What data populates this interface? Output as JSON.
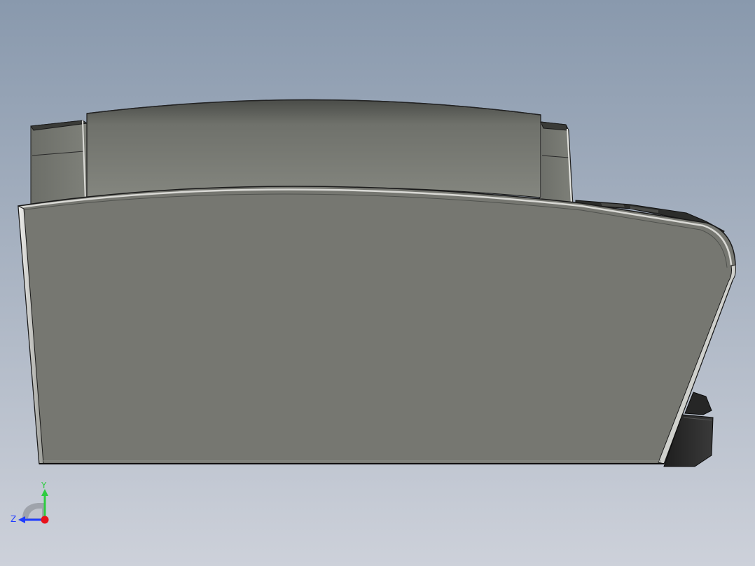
{
  "viewport": {
    "background_top": "#8a9bb0",
    "background_bottom": "#c9ced8",
    "model_face_color": "#757770",
    "model_edge_color": "#1a1a1a",
    "dark_part_color": "#2a2a2a"
  },
  "triad": {
    "y_label": "Y",
    "z_label": "Z",
    "y_color": "#2ecc40",
    "z_color": "#1f3cff",
    "x_color": "#e8121b"
  }
}
